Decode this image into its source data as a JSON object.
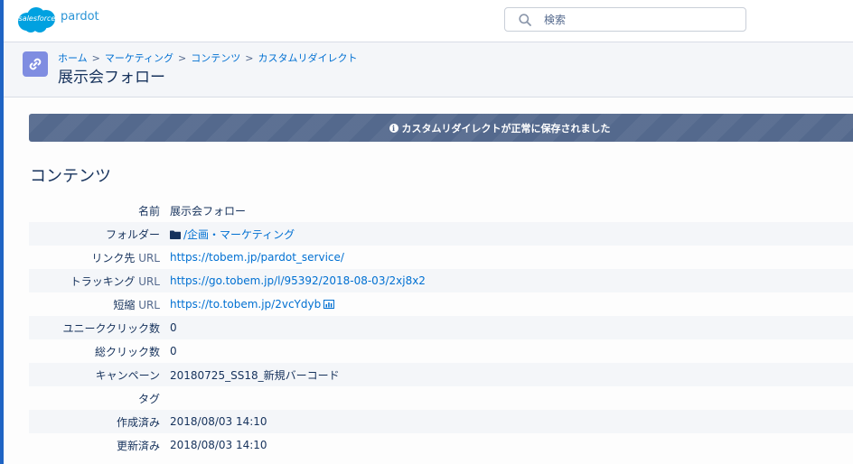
{
  "brand": {
    "salesforce": "salesforce",
    "product": "pardot",
    "cloud_color": "#00a1e0"
  },
  "search": {
    "placeholder": "検索"
  },
  "header": {
    "icon": "link-icon",
    "breadcrumb": [
      "ホーム",
      "マーケティング",
      "コンテンツ",
      "カスタムリダイレクト"
    ],
    "breadcrumb_separator": ">",
    "title": "展示会フォロー"
  },
  "banner": {
    "icon": "info-icon",
    "message": "カスタムリダイレクトが正常に保存されました"
  },
  "section": {
    "title": "コンテンツ"
  },
  "details": [
    {
      "label": "名前",
      "value": "展示会フォロー"
    },
    {
      "label": "フォルダー",
      "value": "/企画・マーケティング",
      "link": true,
      "icon": "folder-icon"
    },
    {
      "label": "リンク先",
      "label_suffix": "URL",
      "value": "https://tobem.jp/pardot_service/",
      "link": true
    },
    {
      "label": "トラッキング",
      "label_suffix": "URL",
      "value": "https://go.tobem.jp/l/95392/2018-08-03/2xj8x2",
      "link": true
    },
    {
      "label": "短縮",
      "label_suffix": "URL",
      "value": "https://to.tobem.jp/2vcYdyb",
      "link": true,
      "icon": "bar-chart-icon"
    },
    {
      "label": "ユニーククリック数",
      "value": "0"
    },
    {
      "label": "総クリック数",
      "value": "0"
    },
    {
      "label": "キャンペーン",
      "value": "20180725_SS18_新規バーコード"
    },
    {
      "label": "タグ",
      "value": ""
    },
    {
      "label": "作成済み",
      "value": "2018/08/03 14:10"
    },
    {
      "label": "更新済み",
      "value": "2018/08/03 14:10"
    }
  ],
  "colors": {
    "accent": "#1f64c4",
    "link": "#0070d2",
    "banner": "#54698d",
    "header_icon": "#7f8de1"
  }
}
